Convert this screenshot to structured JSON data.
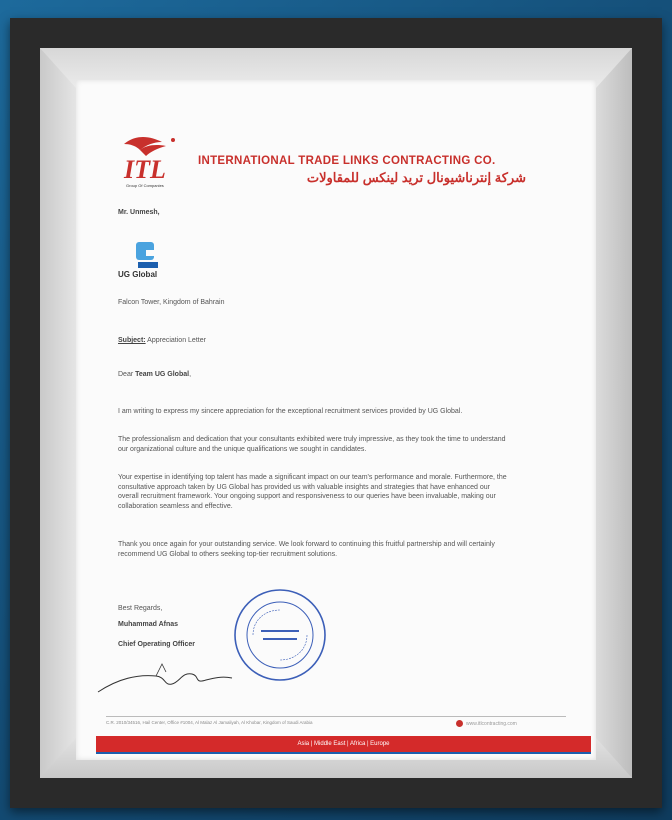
{
  "company": {
    "name_en": "INTERNATIONAL TRADE LINKS CONTRACTING CO.",
    "name_ar": "شركة إنترناشيونال تريد لينكس للمقاولات",
    "logo_text": "ITL",
    "logo_caption": "Group Of Companies"
  },
  "letter": {
    "addressee": "Mr. Unmesh,",
    "recipient_org": "UG Global",
    "address": "Falcon Tower, Kingdom of Bahrain",
    "subject_label": "Subject:",
    "subject_text": " Appreciation Letter",
    "greeting_prefix": "Dear ",
    "greeting_name": "Team UG Global",
    "greeting_suffix": ",",
    "paragraphs": [
      "I am writing to express my sincere appreciation for the exceptional recruitment services provided by UG Global.",
      "The professionalism and dedication that your consultants exhibited were truly impressive, as they took the time to understand our organizational culture and the unique qualifications we sought in candidates.",
      "Your expertise in identifying top talent has made a significant impact on our team's performance and morale. Furthermore, the consultative approach taken by UG Global has provided us with valuable insights and strategies that have enhanced our overall recruitment framework. Your ongoing support and responsiveness to our queries have been invaluable, making our collaboration seamless and effective.",
      "Thank you once again for your outstanding service. We look forward to continuing this fruitful partnership and will certainly recommend UG Global to others seeking top-tier recruitment solutions."
    ],
    "closing": "Best Regards,",
    "signer_name": "Muhammad Afnas",
    "signer_title": "Chief Operating Officer"
  },
  "footer": {
    "address": "C.R. 2010/34516, Hail Center, Office #1004, Al Malaz Al Jamaliyah, Al Khobar, Kingdom of Saudi Arabia",
    "website": "www.itlcontracting.com",
    "band": "Asia | Middle East | Africa | Europe"
  },
  "colors": {
    "brand_red": "#c8302c",
    "band_red": "#d42a2a",
    "band_blue": "#1c5fae",
    "background": "#1b5f8e"
  }
}
